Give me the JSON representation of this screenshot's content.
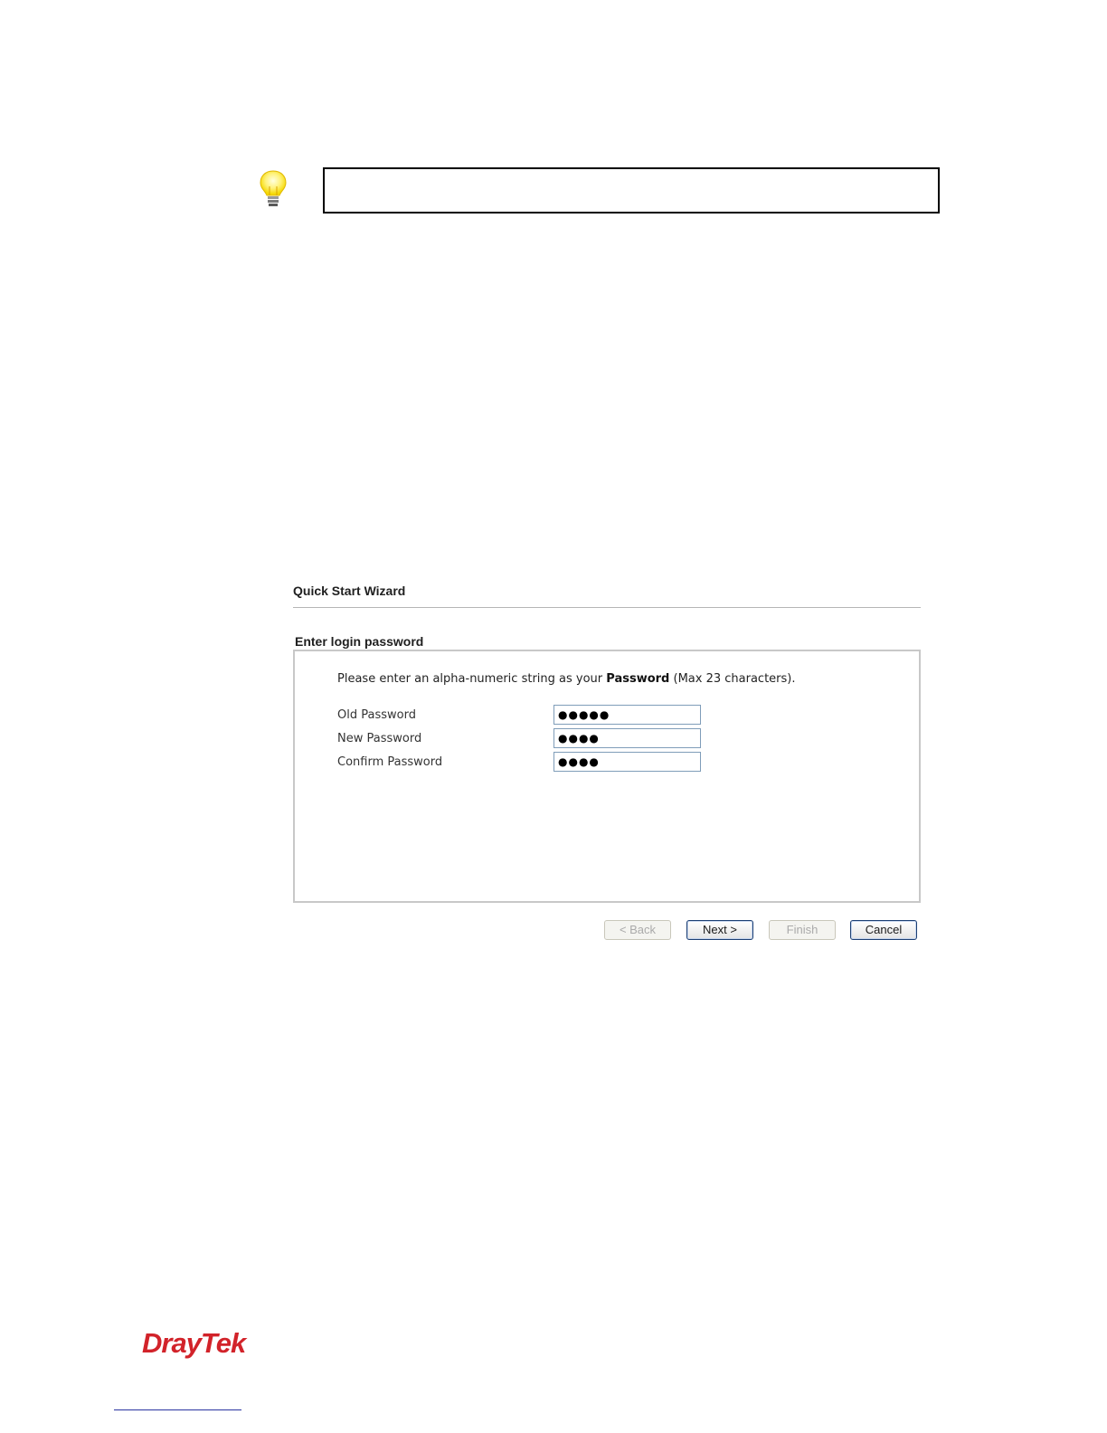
{
  "note": {
    "icon": "lightbulb-icon",
    "text": ""
  },
  "wizard": {
    "title": "Quick Start Wizard",
    "section_label": "Enter login password",
    "intro_prefix": "Please enter an alpha-numeric string as your",
    "intro_bold": "Password",
    "intro_suffix": "(Max 23 characters).",
    "fields": [
      {
        "label": "Old Password",
        "value": "●●●●●"
      },
      {
        "label": "New Password",
        "value": "●●●●"
      },
      {
        "label": "Confirm Password",
        "value": "●●●●"
      }
    ],
    "buttons": {
      "back": "< Back",
      "next": "Next >",
      "finish": "Finish",
      "cancel": "Cancel"
    }
  },
  "brand": {
    "logo_text": "DrayTek",
    "logo_color": "#d2232a"
  },
  "colors": {
    "input_border": "#7f9db9",
    "button_border": "#1c3f73",
    "panel_border": "#c8c8c8"
  }
}
